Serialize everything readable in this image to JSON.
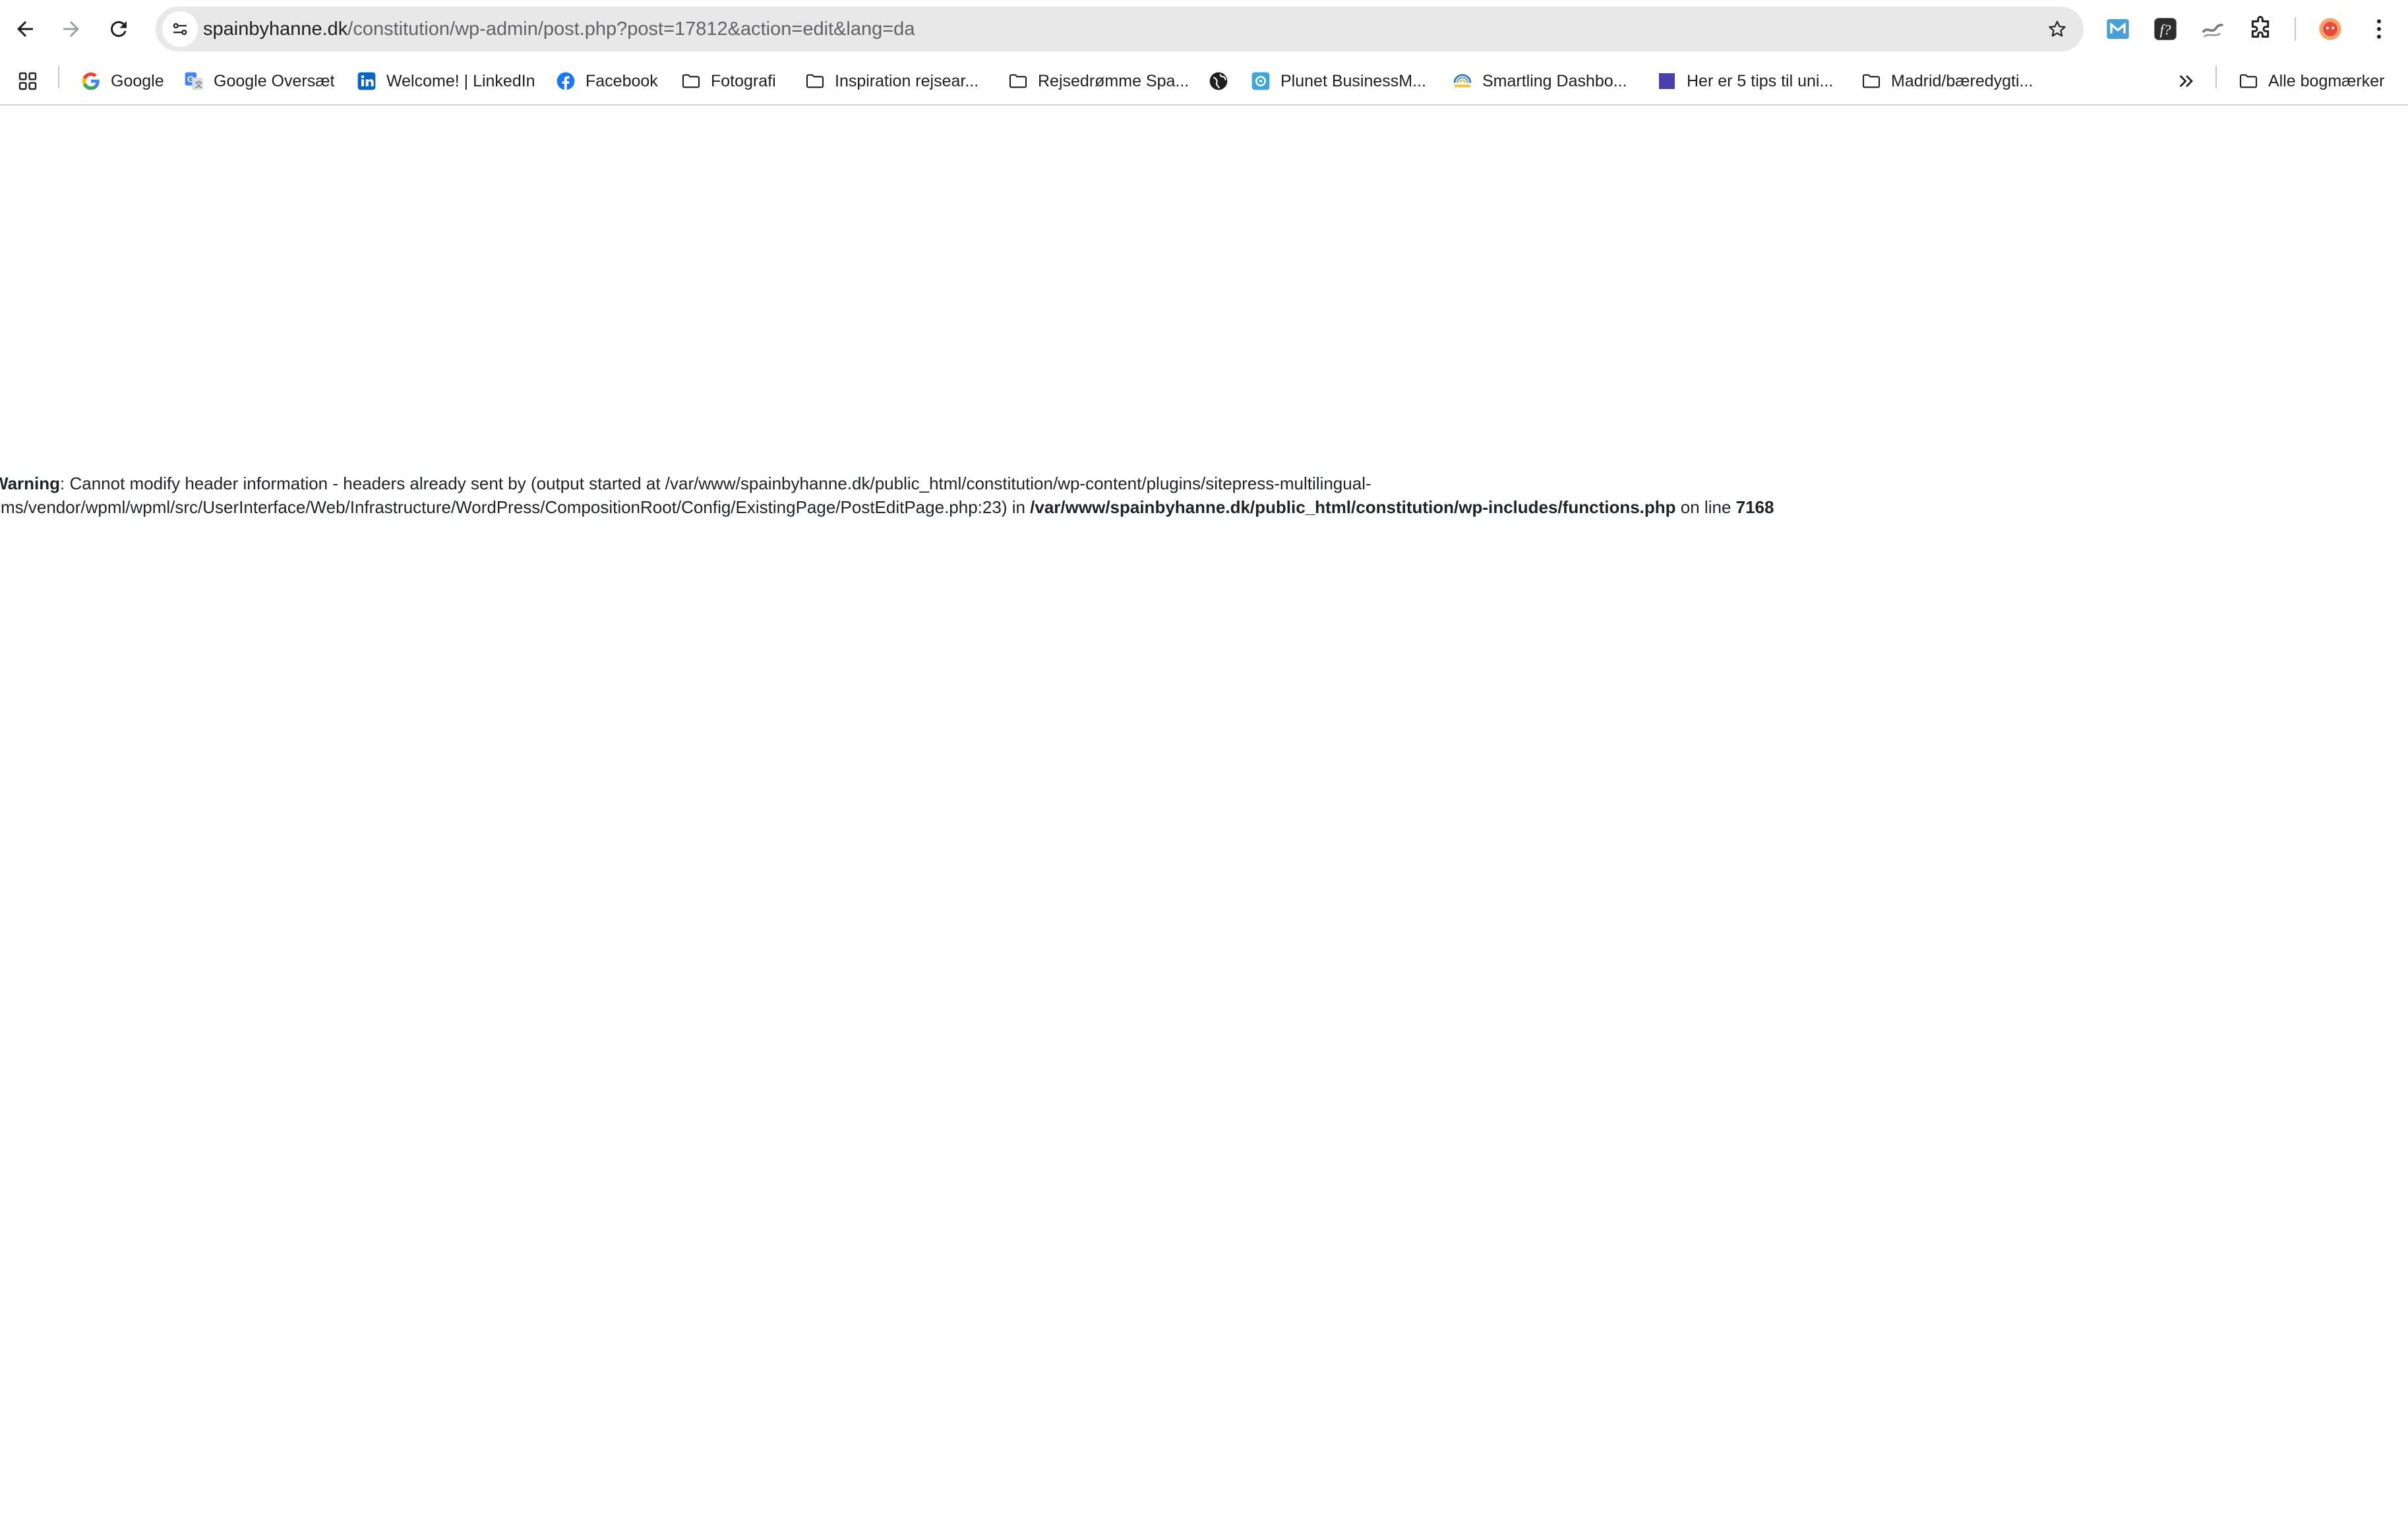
{
  "browser": {
    "url": {
      "host": "spainbyhanne.dk",
      "path": "/constitution/wp-admin/post.php?post=17812&action=edit&lang=da"
    },
    "nav": {
      "back": "back-arrow-icon",
      "forward": "forward-arrow-icon",
      "reload": "reload-icon",
      "apps": "apps-grid-icon"
    },
    "extensions": [
      "m-extension-icon",
      "f-extension-icon",
      "swirl-extension-icon",
      "puzzle-extensions-icon",
      "profile-avatar-icon",
      "kebab-menu-icon"
    ]
  },
  "bookmarks": {
    "items": [
      {
        "label": "Google",
        "icon": "google-icon"
      },
      {
        "label": "Google Oversæt",
        "icon": "google-translate-icon"
      },
      {
        "label": "Welcome! | LinkedIn",
        "icon": "linkedin-icon"
      },
      {
        "label": "Facebook",
        "icon": "facebook-icon"
      },
      {
        "label": "Fotografi",
        "icon": "folder-icon"
      },
      {
        "label": "Inspiration rejsear...",
        "icon": "folder-icon"
      },
      {
        "label": "Rejsedrømme Spa...",
        "icon": "folder-icon"
      },
      {
        "label": "",
        "icon": "globe-icon"
      },
      {
        "label": "Plunet BusinessM...",
        "icon": "plunet-icon"
      },
      {
        "label": "Smartling Dashbo...",
        "icon": "smartling-icon"
      },
      {
        "label": "Her er 5 tips til uni...",
        "icon": "purple-square-icon"
      },
      {
        "label": "Madrid/bæredygti...",
        "icon": "folder-icon"
      }
    ],
    "all_bookmarks": "Alle bogmærker"
  },
  "page": {
    "warning_label": "Warning",
    "warning_text_1": ": Cannot modify header information - headers already sent by (output started at /var/www/spainbyhanne.dk/public_html/constitution/wp-content/plugins/sitepress-multilingual-cms/vendor/wpml/wpml/src/UserInterface/Web/Infrastructure/WordPress/CompositionRoot/Config/ExistingPage/PostEditPage.php:23) in ",
    "warning_file": "/var/www/spainbyhanne.dk/public_html/constitution/wp-includes/functions.php",
    "warning_text_2": " on line ",
    "warning_line": "7168"
  }
}
